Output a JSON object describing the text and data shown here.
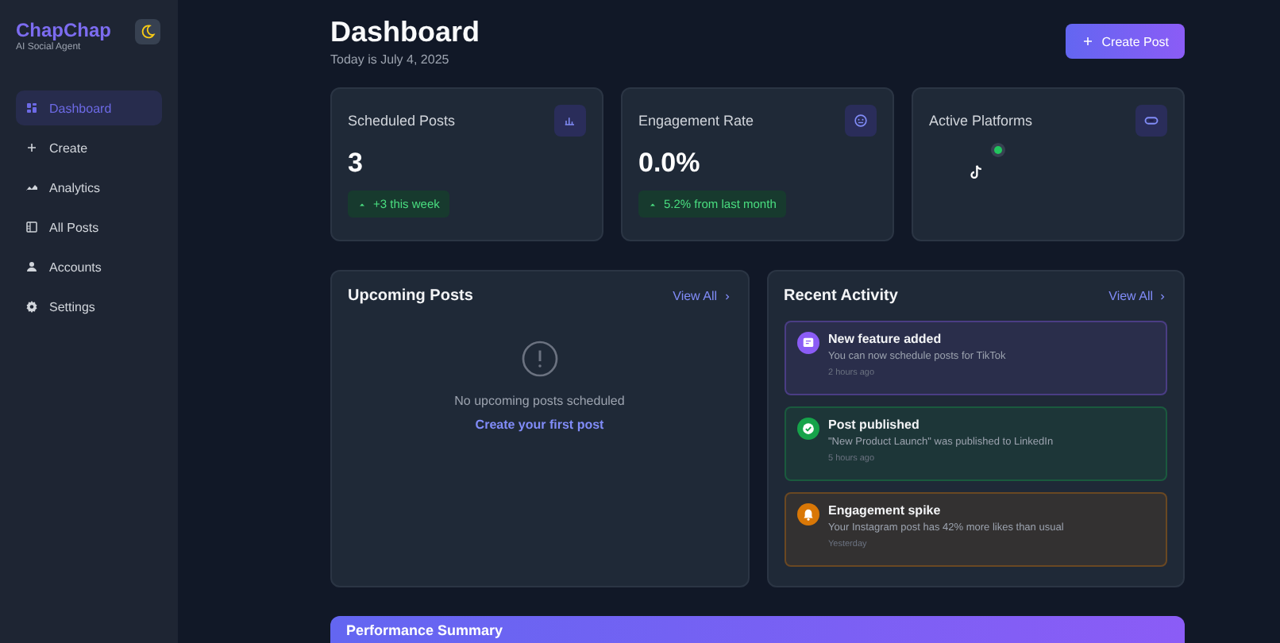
{
  "sidebar": {
    "brand": "ChapChap",
    "tagline": "AI Social Agent",
    "items": [
      {
        "label": "Dashboard",
        "selected": true
      },
      {
        "label": "Create",
        "selected": false
      },
      {
        "label": "Analytics",
        "selected": false
      },
      {
        "label": "All Posts",
        "selected": false
      },
      {
        "label": "Accounts",
        "selected": false
      },
      {
        "label": "Settings",
        "selected": false
      }
    ]
  },
  "header": {
    "title": "Dashboard",
    "subtitle": "Today is July 4, 2025",
    "action": "Create Post"
  },
  "stats": [
    {
      "kind": "number",
      "title": "Scheduled Posts",
      "value": "3",
      "change": "+3 this week"
    },
    {
      "kind": "number",
      "title": "Engagement Rate",
      "value": "0.0%",
      "change": "5.2% from last month"
    },
    {
      "kind": "platforms",
      "title": "Active Platforms",
      "platforms": [
        {
          "connected": true
        }
      ]
    }
  ],
  "upcoming": {
    "title": "Upcoming Posts",
    "view_all": "View All",
    "empty_text": "No upcoming posts scheduled",
    "empty_link": "Create your first post"
  },
  "activity": {
    "title": "Recent Activity",
    "view_all": "View All",
    "items": [
      {
        "kind": "feature",
        "color": "#8b5cf6",
        "title": "New feature added",
        "text": "You can now schedule posts for TikTok",
        "time": "2 hours ago"
      },
      {
        "kind": "published",
        "color": "#16a34a",
        "title": "Post published",
        "text": "\"New Product Launch\" was published to LinkedIn",
        "time": "5 hours ago"
      },
      {
        "kind": "spike",
        "color": "#d97706",
        "title": "Engagement spike",
        "text": "Your Instagram post has 42% more likes than usual",
        "time": "Yesterday"
      }
    ]
  },
  "performance": {
    "title": "Performance Summary"
  }
}
